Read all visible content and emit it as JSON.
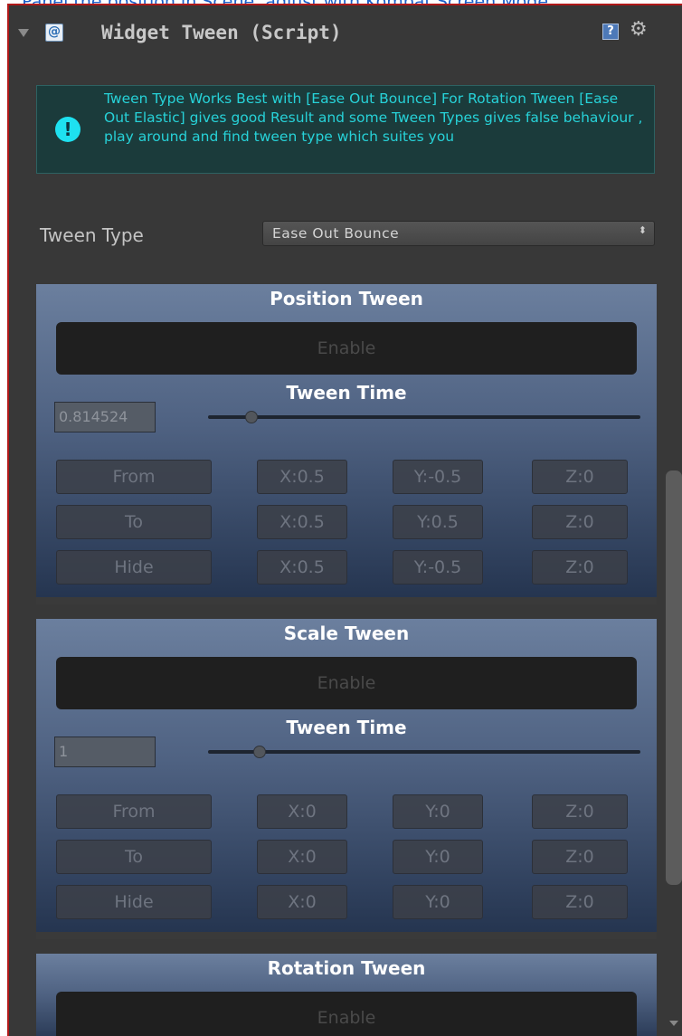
{
  "top_caption": "...Panel the position in Scene, adjust with Kombat Screen Mode",
  "header": {
    "title": "Widget Tween (Script)",
    "script_icon_glyph": "@",
    "help_icon_glyph": "?",
    "gear_icon_glyph": "⚙"
  },
  "info_box": {
    "icon_glyph": "!",
    "message": "Tween Type Works Best with [Ease Out Bounce] For Rotation Tween [Ease Out Elastic] gives good Result and some Tween Types gives false behaviour , play around and find tween type which suites you"
  },
  "tween_type": {
    "label": "Tween Type",
    "selected": "Ease Out Bounce",
    "arrows": "⬍"
  },
  "panels": [
    {
      "title": "Position Tween",
      "enable_label": "Enable",
      "time_title": "Tween Time",
      "time_value": "0.814524",
      "slider_value": 0.1,
      "rows": [
        {
          "label": "From",
          "x": "X:0.5",
          "y": "Y:-0.5",
          "z": "Z:0"
        },
        {
          "label": "To",
          "x": "X:0.5",
          "y": "Y:0.5",
          "z": "Z:0"
        },
        {
          "label": "Hide",
          "x": "X:0.5",
          "y": "Y:-0.5",
          "z": "Z:0"
        }
      ]
    },
    {
      "title": "Scale Tween",
      "enable_label": "Enable",
      "time_title": "Tween Time",
      "time_value": "1",
      "slider_value": 0.12,
      "rows": [
        {
          "label": "From",
          "x": "X:0",
          "y": "Y:0",
          "z": "Z:0"
        },
        {
          "label": "To",
          "x": "X:0",
          "y": "Y:0",
          "z": "Z:0"
        },
        {
          "label": "Hide",
          "x": "X:0",
          "y": "Y:0",
          "z": "Z:0"
        }
      ]
    },
    {
      "title": "Rotation Tween",
      "enable_label": "Enable"
    }
  ],
  "colors": {
    "inspector_bg": "#383838",
    "info_text": "#27d2d8",
    "panel_top": "#6b7f9e",
    "panel_bottom": "#253550"
  }
}
